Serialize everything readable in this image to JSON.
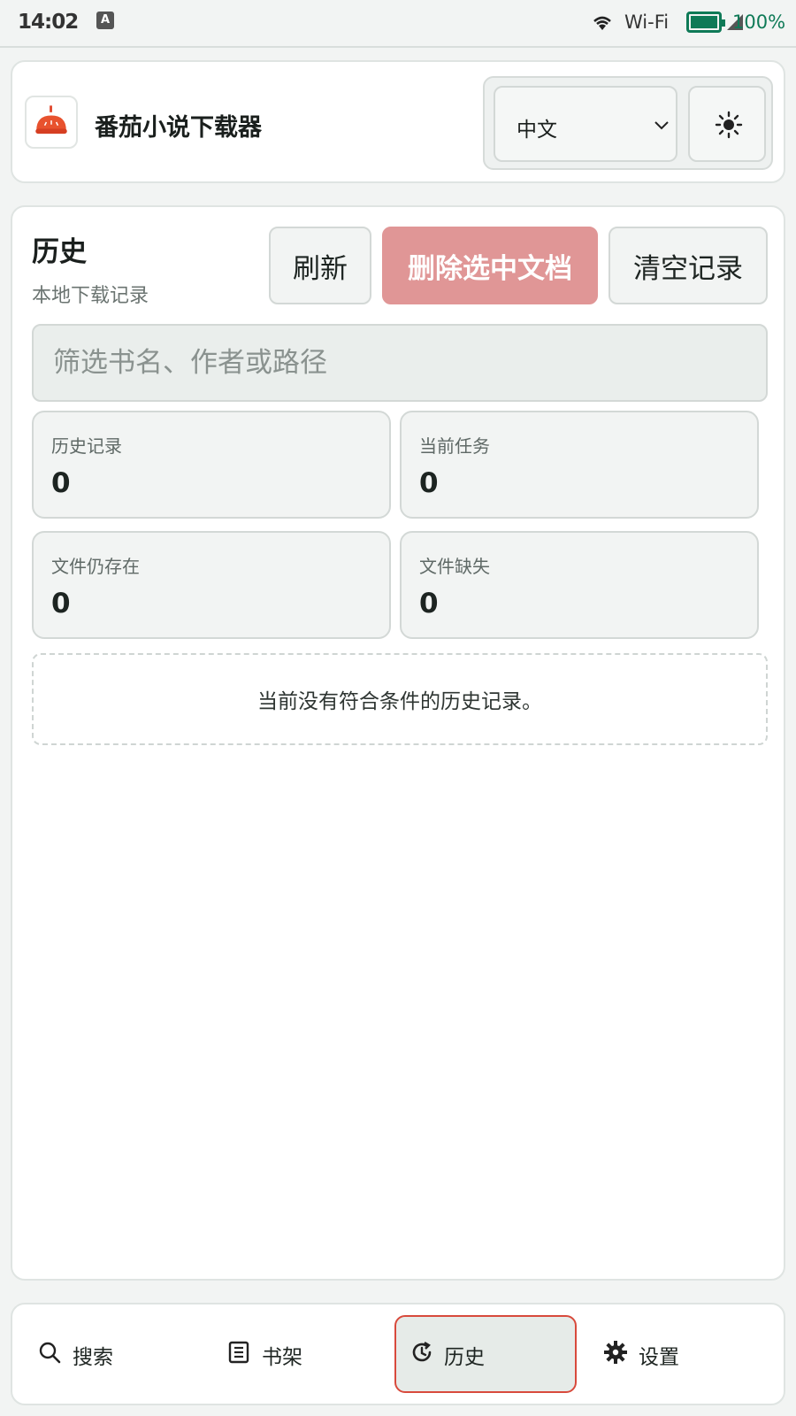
{
  "status_bar": {
    "time": "14:02",
    "wifi_label": "Wi-Fi",
    "battery_percent": "100%"
  },
  "header": {
    "app_title": "番茄小说下载器",
    "language_value": "中文",
    "logo_icon": "tomato-logo-icon",
    "theme_icon": "sun-icon"
  },
  "history": {
    "title": "历史",
    "subtitle": "本地下载记录",
    "refresh_label": "刷新",
    "delete_label": "删除选中文档",
    "clear_label": "清空记录",
    "filter_placeholder": "筛选书名、作者或路径",
    "filter_value": "",
    "stats": [
      {
        "label": "历史记录",
        "value": "0"
      },
      {
        "label": "当前任务",
        "value": "0"
      },
      {
        "label": "文件仍存在",
        "value": "0"
      },
      {
        "label": "文件缺失",
        "value": "0"
      }
    ],
    "empty_message": "当前没有符合条件的历史记录。"
  },
  "nav": {
    "items": [
      {
        "label": "搜索",
        "icon": "search-icon",
        "active": false
      },
      {
        "label": "书架",
        "icon": "bookshelf-icon",
        "active": false
      },
      {
        "label": "历史",
        "icon": "history-icon",
        "active": true
      },
      {
        "label": "设置",
        "icon": "gear-icon",
        "active": false
      }
    ]
  },
  "colors": {
    "accent": "#d84a3c",
    "delete_button": "#e09696",
    "battery": "#0f7a57"
  }
}
